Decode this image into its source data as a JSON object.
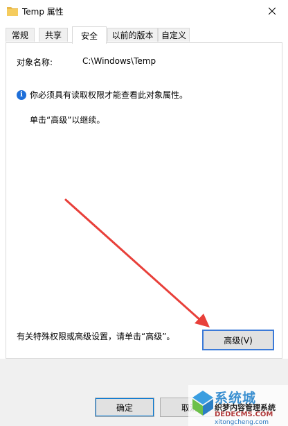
{
  "window": {
    "title": "Temp 属性",
    "close_glyph": "✕"
  },
  "tabs": [
    {
      "label": "常规",
      "active": false
    },
    {
      "label": "共享",
      "active": false
    },
    {
      "label": "安全",
      "active": true
    },
    {
      "label": "以前的版本",
      "active": false
    },
    {
      "label": "自定义",
      "active": false
    }
  ],
  "security": {
    "object_name_label": "对象名称:",
    "object_name_value": "C:\\Windows\\Temp",
    "info_message": "你必须具有读取权限才能查看此对象属性。",
    "continue_message": "单击“高级”以继续。",
    "special_permissions_text": "有关特殊权限或高级设置，请单击“高级”。",
    "advanced_button": "高级(V)"
  },
  "footer": {
    "ok_button": "确定",
    "cancel_button": "取消"
  },
  "watermark": {
    "title": "系统城",
    "line1": "织梦内容管理系统",
    "line2": "DEDECMS.COM",
    "line3": "xitongcheng.com"
  },
  "colors": {
    "arrow": "#e8403a",
    "accent": "#0078d7",
    "folder": "#e8b84a"
  }
}
